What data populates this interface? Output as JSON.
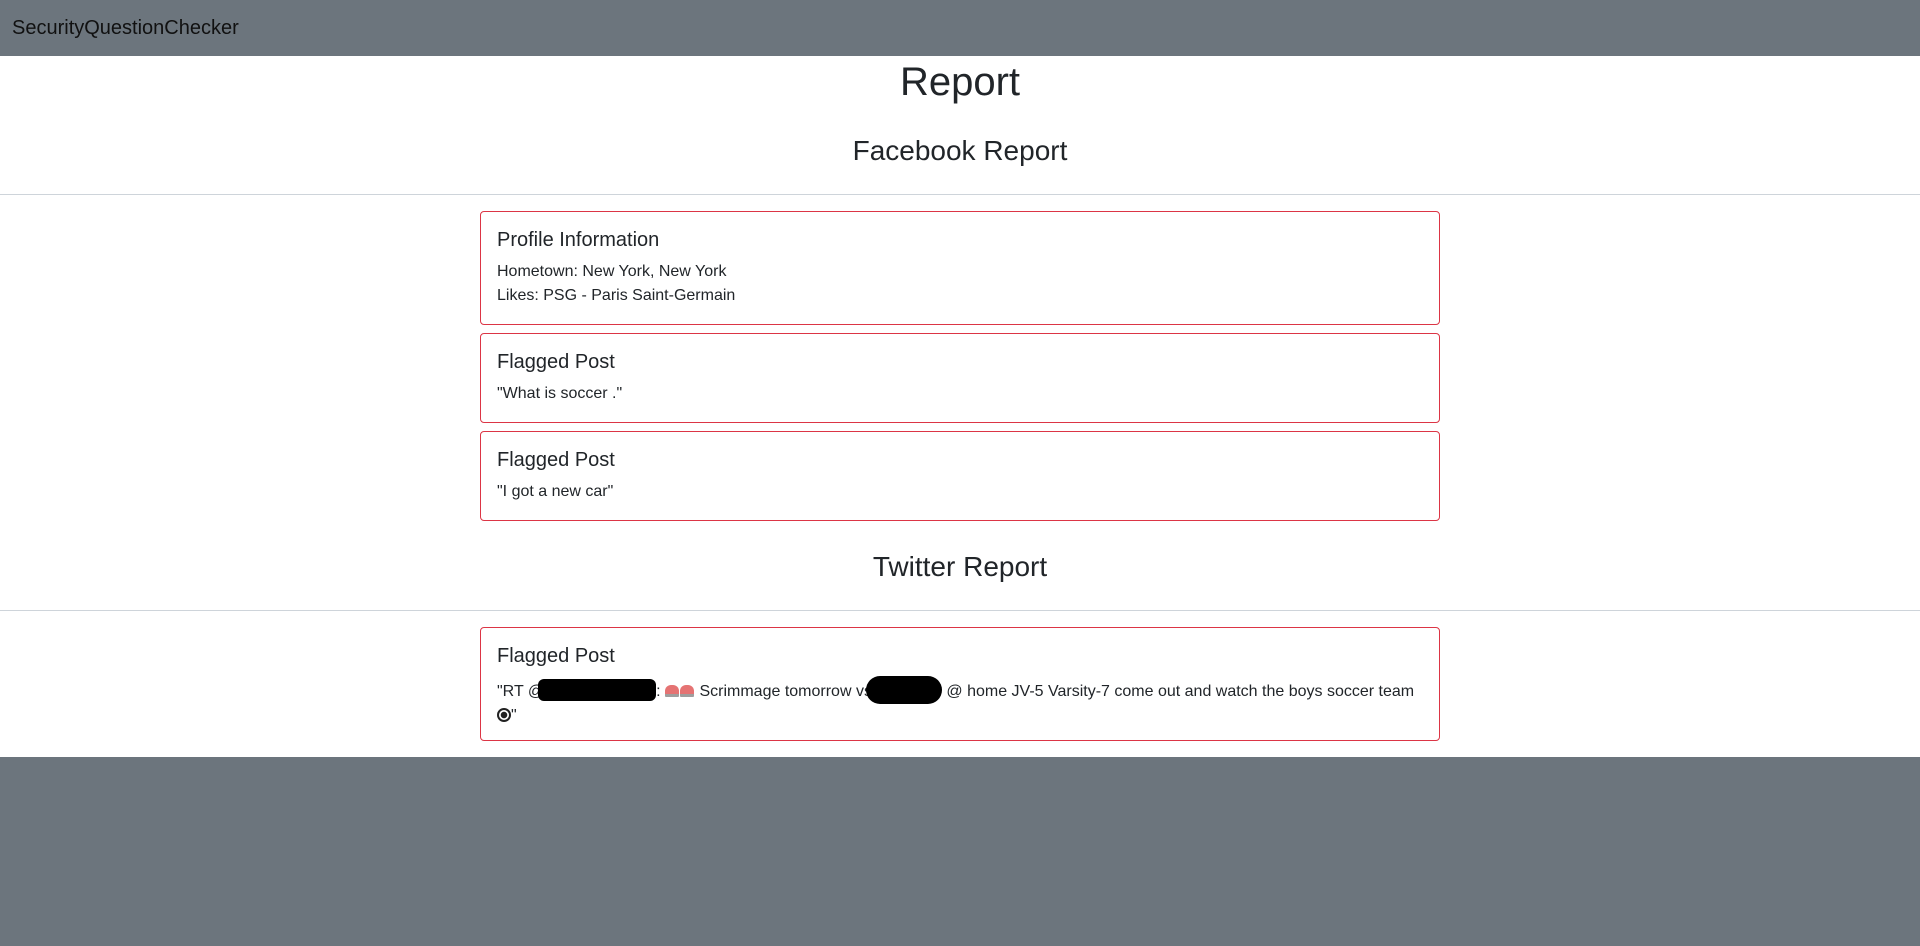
{
  "app": {
    "brand": "SecurityQuestionChecker"
  },
  "page": {
    "title": "Report"
  },
  "facebook": {
    "title": "Facebook Report",
    "profile": {
      "title": "Profile Information",
      "hometown": "Hometown: New York, New York",
      "likes": "Likes: PSG - Paris Saint-Germain"
    },
    "posts": [
      {
        "title": "Flagged Post",
        "text": "\"What is soccer .\""
      },
      {
        "title": "Flagged Post",
        "text": "\"I got a new car\""
      }
    ]
  },
  "twitter": {
    "title": "Twitter Report",
    "posts": [
      {
        "title": "Flagged Post",
        "text_start": "\"RT @",
        "text_mid": ": ",
        "text_mid2": " Scrimmage tomorrow vs",
        "text_end": " @ home JV-5 Varsity-7 come out and watch the boys soccer team",
        "text_close": "\"",
        "icons": [
          "siren-icon",
          "siren-icon",
          "soccer-ball-icon"
        ]
      }
    ]
  },
  "colors": {
    "navbar": "#6c757d",
    "card_border": "#dc3545",
    "background": "#ffffff"
  }
}
